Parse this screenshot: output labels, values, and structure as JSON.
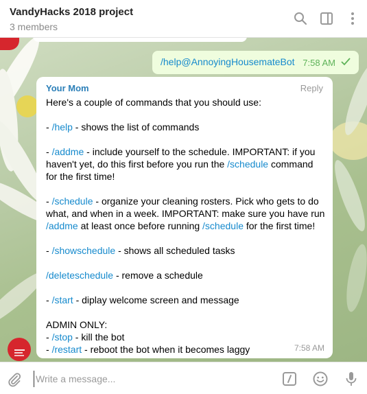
{
  "header": {
    "title": "VandyHacks 2018 project",
    "subtitle": "3 members",
    "icons": [
      "search-icon",
      "sidebar-toggle-icon",
      "more-vertical-icon"
    ]
  },
  "outgoing": {
    "text": "/help@AnnoyingHousemateBot",
    "time": "7:58 AM",
    "status_icon": "double-check-icon"
  },
  "incoming": {
    "sender": "Your Mom",
    "reply_label": "Reply",
    "time": "7:58 AM",
    "lines": {
      "intro": "Here's a couple of commands that you should use:",
      "help_dash": "- ",
      "help_cmd": "/help",
      "help_rest": " - shows the list of commands",
      "addme_dash": "- ",
      "addme_cmd": "/addme",
      "addme_rest": " - include yourself to the schedule. IMPORTANT: if you",
      "addme_l2a": "haven't yet, do this first before you run the ",
      "addme_l2cmd": "/schedule",
      "addme_l2b": " command",
      "addme_l3": "for the first time!",
      "sched_dash": "- ",
      "sched_cmd": "/schedule",
      "sched_rest": " - organize your cleaning rosters. Pick who gets to do",
      "sched_l2": "what, and when in a week. IMPORTANT: make sure you have run",
      "sched_l3cmd1": "/addme",
      "sched_l3a": " at least once before running ",
      "sched_l3cmd2": "/schedule",
      "sched_l3b": " for the first time!",
      "show_dash": "- ",
      "show_cmd": "/showschedule",
      "show_rest": " - shows all scheduled tasks",
      "del_cmd": "/deleteschedule",
      "del_rest": " - remove a schedule",
      "start_dash": "- ",
      "start_cmd": "/start",
      "start_rest": " - diplay welcome screen and message",
      "admin": "ADMIN ONLY:",
      "stop_dash": "- ",
      "stop_cmd": "/stop",
      "stop_rest": " - kill the bot",
      "restart_dash": "- ",
      "restart_cmd": "/restart",
      "restart_rest": " - reboot the bot when it becomes laggy"
    }
  },
  "input": {
    "placeholder": "Write a message...",
    "icons": [
      "attach-icon",
      "bot-command-icon",
      "emoji-icon",
      "microphone-icon"
    ]
  },
  "colors": {
    "link": "#168acd",
    "sender": "#2b7fb8",
    "outgoing_bg": "#effdde",
    "outgoing_time": "#5db258",
    "avatar": "#d6262d"
  }
}
